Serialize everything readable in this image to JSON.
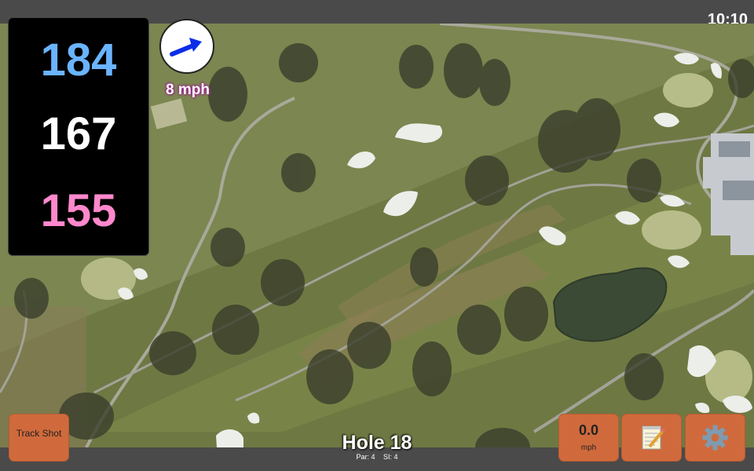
{
  "status_bar": {
    "time": "10:10"
  },
  "distances": {
    "back": "184",
    "middle": "167",
    "front": "155"
  },
  "wind": {
    "speed_label": "8 mph",
    "icon": "wind-direction-arrow-icon"
  },
  "buttons": {
    "track_shot": "Track Shot",
    "speed_value": "0.0",
    "speed_unit": "mph",
    "notes_icon": "notepad-icon",
    "settings_icon": "gear-icon"
  },
  "hole": {
    "title": "Hole 18",
    "par": "Par: 4",
    "si": "SI: 4"
  },
  "colors": {
    "back": "#6ab4ff",
    "middle": "#ffffff",
    "front": "#ff88cc",
    "button": "#d06a3c"
  }
}
